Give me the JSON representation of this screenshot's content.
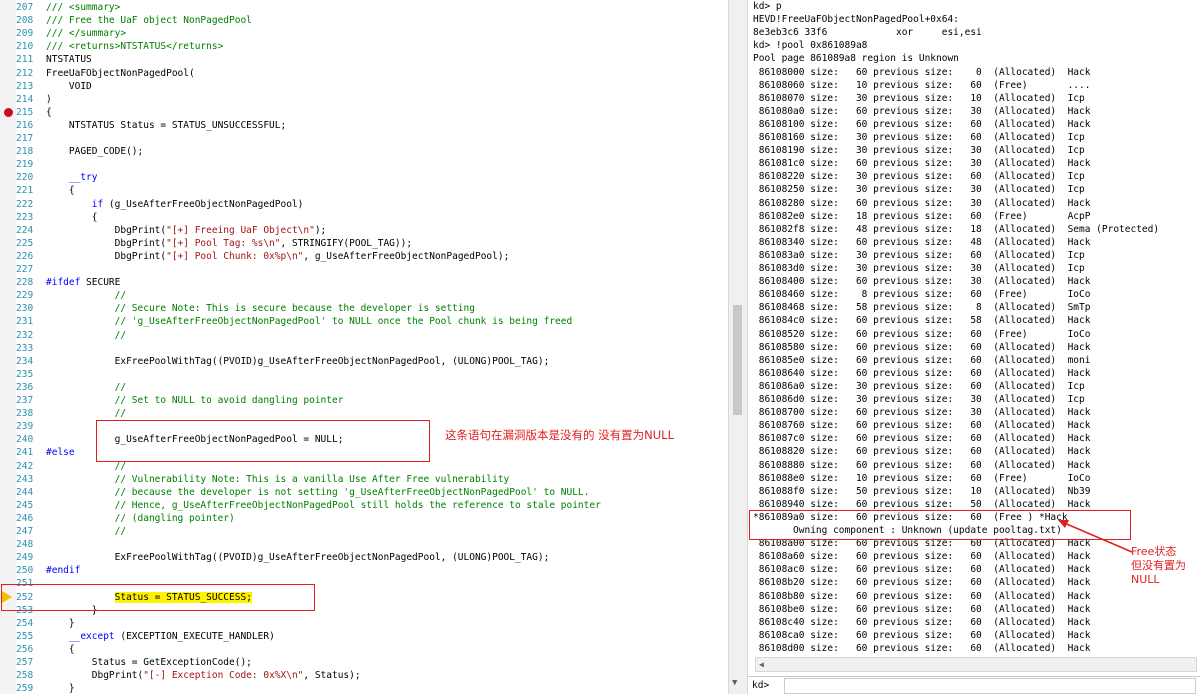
{
  "editor": {
    "lines": [
      {
        "n": "207",
        "parts": [
          [
            "c-cm",
            "/// <summary>"
          ]
        ]
      },
      {
        "n": "208",
        "parts": [
          [
            "c-cm",
            "/// Free the UaF object NonPagedPool"
          ]
        ]
      },
      {
        "n": "209",
        "parts": [
          [
            "c-cm",
            "/// </summary>"
          ]
        ]
      },
      {
        "n": "210",
        "parts": [
          [
            "c-cm",
            "/// <returns>NTSTATUS</returns>"
          ]
        ]
      },
      {
        "n": "211",
        "parts": [
          [
            "c-tx",
            "NTSTATUS"
          ]
        ]
      },
      {
        "n": "212",
        "parts": [
          [
            "c-tx",
            "FreeUaFObjectNonPagedPool("
          ]
        ]
      },
      {
        "n": "213",
        "parts": [
          [
            "c-tx",
            "    VOID"
          ]
        ]
      },
      {
        "n": "214",
        "parts": [
          [
            "c-tx",
            ")"
          ]
        ]
      },
      {
        "n": "215",
        "parts": [
          [
            "c-tx",
            "{"
          ]
        ]
      },
      {
        "n": "216",
        "parts": [
          [
            "c-tx",
            "    NTSTATUS Status = STATUS_UNSUCCESSFUL;"
          ]
        ]
      },
      {
        "n": "217",
        "parts": [
          [
            "c-tx",
            ""
          ]
        ]
      },
      {
        "n": "218",
        "parts": [
          [
            "c-tx",
            "    PAGED_CODE();"
          ]
        ]
      },
      {
        "n": "219",
        "parts": [
          [
            "c-tx",
            ""
          ]
        ]
      },
      {
        "n": "220",
        "parts": [
          [
            "c-kw",
            "    __try"
          ]
        ]
      },
      {
        "n": "221",
        "parts": [
          [
            "c-tx",
            "    {"
          ]
        ]
      },
      {
        "n": "222",
        "parts": [
          [
            "c-kw",
            "        if"
          ],
          [
            "c-tx",
            " (g_UseAfterFreeObjectNonPagedPool)"
          ]
        ]
      },
      {
        "n": "223",
        "parts": [
          [
            "c-tx",
            "        {"
          ]
        ]
      },
      {
        "n": "224",
        "parts": [
          [
            "c-tx",
            "            DbgPrint("
          ],
          [
            "c-str",
            "\"[+] Freeing UaF Object\\n\""
          ],
          [
            "c-tx",
            ");"
          ]
        ]
      },
      {
        "n": "225",
        "parts": [
          [
            "c-tx",
            "            DbgPrint("
          ],
          [
            "c-str",
            "\"[+] Pool Tag: %s\\n\""
          ],
          [
            "c-tx",
            ", STRINGIFY(POOL_TAG));"
          ]
        ]
      },
      {
        "n": "226",
        "parts": [
          [
            "c-tx",
            "            DbgPrint("
          ],
          [
            "c-str",
            "\"[+] Pool Chunk: 0x%p\\n\""
          ],
          [
            "c-tx",
            ", g_UseAfterFreeObjectNonPagedPool);"
          ]
        ]
      },
      {
        "n": "227",
        "parts": [
          [
            "c-tx",
            ""
          ]
        ]
      },
      {
        "n": "228",
        "parts": [
          [
            "c-kw",
            "#ifdef"
          ],
          [
            "c-tx",
            " SECURE"
          ]
        ]
      },
      {
        "n": "229",
        "parts": [
          [
            "c-cm",
            "            //"
          ]
        ]
      },
      {
        "n": "230",
        "parts": [
          [
            "c-cm",
            "            // Secure Note: This is secure because the developer is setting"
          ]
        ]
      },
      {
        "n": "231",
        "parts": [
          [
            "c-cm",
            "            // 'g_UseAfterFreeObjectNonPagedPool' to NULL once the Pool chunk is being freed"
          ]
        ]
      },
      {
        "n": "232",
        "parts": [
          [
            "c-cm",
            "            //"
          ]
        ]
      },
      {
        "n": "233",
        "parts": [
          [
            "c-tx",
            ""
          ]
        ]
      },
      {
        "n": "234",
        "parts": [
          [
            "c-tx",
            "            ExFreePoolWithTag((PVOID)g_UseAfterFreeObjectNonPagedPool, (ULONG)POOL_TAG);"
          ]
        ]
      },
      {
        "n": "235",
        "parts": [
          [
            "c-tx",
            ""
          ]
        ]
      },
      {
        "n": "236",
        "parts": [
          [
            "c-cm",
            "            //"
          ]
        ]
      },
      {
        "n": "237",
        "parts": [
          [
            "c-cm",
            "            // Set to NULL to avoid dangling pointer"
          ]
        ]
      },
      {
        "n": "238",
        "parts": [
          [
            "c-cm",
            "            //"
          ]
        ]
      },
      {
        "n": "239",
        "parts": [
          [
            "c-tx",
            ""
          ]
        ]
      },
      {
        "n": "240",
        "parts": [
          [
            "c-tx",
            "            g_UseAfterFreeObjectNonPagedPool = NULL;"
          ]
        ]
      },
      {
        "n": "241",
        "parts": [
          [
            "c-kw",
            "#else"
          ]
        ]
      },
      {
        "n": "242",
        "parts": [
          [
            "c-cm",
            "            //"
          ]
        ]
      },
      {
        "n": "243",
        "parts": [
          [
            "c-cm",
            "            // Vulnerability Note: This is a vanilla Use After Free vulnerability"
          ]
        ]
      },
      {
        "n": "244",
        "parts": [
          [
            "c-cm",
            "            // because the developer is not setting 'g_UseAfterFreeObjectNonPagedPool' to NULL."
          ]
        ]
      },
      {
        "n": "245",
        "parts": [
          [
            "c-cm",
            "            // Hence, g_UseAfterFreeObjectNonPagedPool still holds the reference to stale pointer"
          ]
        ]
      },
      {
        "n": "246",
        "parts": [
          [
            "c-cm",
            "            // (dangling pointer)"
          ]
        ]
      },
      {
        "n": "247",
        "parts": [
          [
            "c-cm",
            "            //"
          ]
        ]
      },
      {
        "n": "248",
        "parts": [
          [
            "c-tx",
            ""
          ]
        ]
      },
      {
        "n": "249",
        "parts": [
          [
            "c-tx",
            "            ExFreePoolWithTag((PVOID)g_UseAfterFreeObjectNonPagedPool, (ULONG)POOL_TAG);"
          ]
        ]
      },
      {
        "n": "250",
        "parts": [
          [
            "c-kw",
            "#endif"
          ]
        ]
      },
      {
        "n": "251",
        "parts": [
          [
            "c-tx",
            ""
          ]
        ]
      },
      {
        "n": "252",
        "parts": [
          [
            "c-tx",
            "            "
          ],
          [
            "hl-stmt",
            "Status = STATUS_SUCCESS;"
          ]
        ]
      },
      {
        "n": "253",
        "parts": [
          [
            "c-tx",
            "        }"
          ]
        ]
      },
      {
        "n": "254",
        "parts": [
          [
            "c-tx",
            "    }"
          ]
        ]
      },
      {
        "n": "255",
        "parts": [
          [
            "c-kw",
            "    __except"
          ],
          [
            "c-tx",
            " (EXCEPTION_EXECUTE_HANDLER)"
          ]
        ]
      },
      {
        "n": "256",
        "parts": [
          [
            "c-tx",
            "    {"
          ]
        ]
      },
      {
        "n": "257",
        "parts": [
          [
            "c-tx",
            "        Status = GetExceptionCode();"
          ]
        ]
      },
      {
        "n": "258",
        "parts": [
          [
            "c-tx",
            "        DbgPrint("
          ],
          [
            "c-str",
            "\"[-] Exception Code: 0x%X\\n\""
          ],
          [
            "c-tx",
            ", Status);"
          ]
        ]
      },
      {
        "n": "259",
        "parts": [
          [
            "c-tx",
            "    }"
          ]
        ]
      }
    ],
    "breakpoint_line": "215",
    "current_line": "252",
    "annotation_text": "这条语句在漏洞版本是没有的 没有置为NULL"
  },
  "debugger": {
    "lines": [
      "kd> p",
      "HEVD!FreeUaFObjectNonPagedPool+0x64:",
      "8e3eb3c6 33f6            xor     esi,esi",
      "kd> !pool 0x861089a8",
      "Pool page 861089a8 region is Unknown",
      " 86108000 size:   60 previous size:    0  (Allocated)  Hack",
      " 86108060 size:   10 previous size:   60  (Free)       ....",
      " 86108070 size:   30 previous size:   10  (Allocated)  Icp",
      " 861080a0 size:   60 previous size:   30  (Allocated)  Hack",
      " 86108100 size:   60 previous size:   60  (Allocated)  Hack",
      " 86108160 size:   30 previous size:   60  (Allocated)  Icp",
      " 86108190 size:   30 previous size:   30  (Allocated)  Icp",
      " 861081c0 size:   60 previous size:   30  (Allocated)  Hack",
      " 86108220 size:   30 previous size:   60  (Allocated)  Icp",
      " 86108250 size:   30 previous size:   30  (Allocated)  Icp",
      " 86108280 size:   60 previous size:   30  (Allocated)  Hack",
      " 861082e0 size:   18 previous size:   60  (Free)       AcpP",
      " 861082f8 size:   48 previous size:   18  (Allocated)  Sema (Protected)",
      " 86108340 size:   60 previous size:   48  (Allocated)  Hack",
      " 861083a0 size:   30 previous size:   60  (Allocated)  Icp",
      " 861083d0 size:   30 previous size:   30  (Allocated)  Icp",
      " 86108400 size:   60 previous size:   30  (Allocated)  Hack",
      " 86108460 size:    8 previous size:   60  (Free)       IoCo",
      " 86108468 size:   58 previous size:    8  (Allocated)  SmTp",
      " 861084c0 size:   60 previous size:   58  (Allocated)  Hack",
      " 86108520 size:   60 previous size:   60  (Free)       IoCo",
      " 86108580 size:   60 previous size:   60  (Allocated)  Hack",
      " 861085e0 size:   60 previous size:   60  (Allocated)  moni",
      " 86108640 size:   60 previous size:   60  (Allocated)  Hack",
      " 861086a0 size:   30 previous size:   60  (Allocated)  Icp",
      " 861086d0 size:   30 previous size:   30  (Allocated)  Icp",
      " 86108700 size:   60 previous size:   30  (Allocated)  Hack",
      " 86108760 size:   60 previous size:   60  (Allocated)  Hack",
      " 861087c0 size:   60 previous size:   60  (Allocated)  Hack",
      " 86108820 size:   60 previous size:   60  (Allocated)  Hack",
      " 86108880 size:   60 previous size:   60  (Allocated)  Hack",
      " 861088e0 size:   10 previous size:   60  (Free)       IoCo",
      " 861088f0 size:   50 previous size:   10  (Allocated)  Nb39",
      " 86108940 size:   60 previous size:   50  (Allocated)  Hack",
      "*861089a0 size:   60 previous size:   60  (Free ) *Hack",
      "       Owning component : Unknown (update pooltag.txt)",
      " 86108a00 size:   60 previous size:   60  (Allocated)  Hack",
      " 86108a60 size:   60 previous size:   60  (Allocated)  Hack",
      " 86108ac0 size:   60 previous size:   60  (Allocated)  Hack",
      " 86108b20 size:   60 previous size:   60  (Allocated)  Hack",
      " 86108b80 size:   60 previous size:   60  (Allocated)  Hack",
      " 86108be0 size:   60 previous size:   60  (Allocated)  Hack",
      " 86108c40 size:   60 previous size:   60  (Allocated)  Hack",
      " 86108ca0 size:   60 previous size:   60  (Allocated)  Hack",
      " 86108d00 size:   60 previous size:   60  (Allocated)  Hack"
    ],
    "annotation_lines": [
      "Free状态",
      "但没有置为",
      "NULL"
    ],
    "command_prompt": "kd>",
    "command_value": ""
  }
}
